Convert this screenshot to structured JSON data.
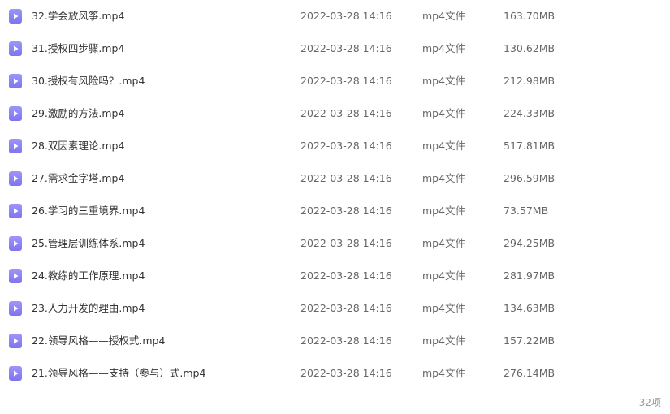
{
  "files": [
    {
      "name": "32.学会放风筝.mp4",
      "date": "2022-03-28 14:16",
      "type": "mp4文件",
      "size": "163.70MB",
      "icon": "video-file-icon"
    },
    {
      "name": "31.授权四步骤.mp4",
      "date": "2022-03-28 14:16",
      "type": "mp4文件",
      "size": "130.62MB",
      "icon": "video-file-icon"
    },
    {
      "name": "30.授权有风险吗？.mp4",
      "date": "2022-03-28 14:16",
      "type": "mp4文件",
      "size": "212.98MB",
      "icon": "video-file-icon"
    },
    {
      "name": "29.激励的方法.mp4",
      "date": "2022-03-28 14:16",
      "type": "mp4文件",
      "size": "224.33MB",
      "icon": "video-file-icon"
    },
    {
      "name": "28.双因素理论.mp4",
      "date": "2022-03-28 14:16",
      "type": "mp4文件",
      "size": "517.81MB",
      "icon": "video-file-icon"
    },
    {
      "name": "27.需求金字塔.mp4",
      "date": "2022-03-28 14:16",
      "type": "mp4文件",
      "size": "296.59MB",
      "icon": "video-file-icon"
    },
    {
      "name": "26.学习的三重境界.mp4",
      "date": "2022-03-28 14:16",
      "type": "mp4文件",
      "size": "73.57MB",
      "icon": "video-file-icon"
    },
    {
      "name": "25.管理层训练体系.mp4",
      "date": "2022-03-28 14:16",
      "type": "mp4文件",
      "size": "294.25MB",
      "icon": "video-file-icon"
    },
    {
      "name": "24.教练的工作原理.mp4",
      "date": "2022-03-28 14:16",
      "type": "mp4文件",
      "size": "281.97MB",
      "icon": "video-file-icon"
    },
    {
      "name": "23.人力开发的理由.mp4",
      "date": "2022-03-28 14:16",
      "type": "mp4文件",
      "size": "134.63MB",
      "icon": "video-file-icon"
    },
    {
      "name": "22.领导风格——授权式.mp4",
      "date": "2022-03-28 14:16",
      "type": "mp4文件",
      "size": "157.22MB",
      "icon": "video-file-icon"
    },
    {
      "name": "21.领导风格——支持（参与）式.mp4",
      "date": "2022-03-28 14:16",
      "type": "mp4文件",
      "size": "276.14MB",
      "icon": "video-file-icon"
    }
  ],
  "footer": {
    "item_count": "32项"
  },
  "colors": {
    "icon_fill": "#8f86f7",
    "text_primary": "#333333",
    "text_secondary": "#666666",
    "text_muted": "#999999"
  }
}
